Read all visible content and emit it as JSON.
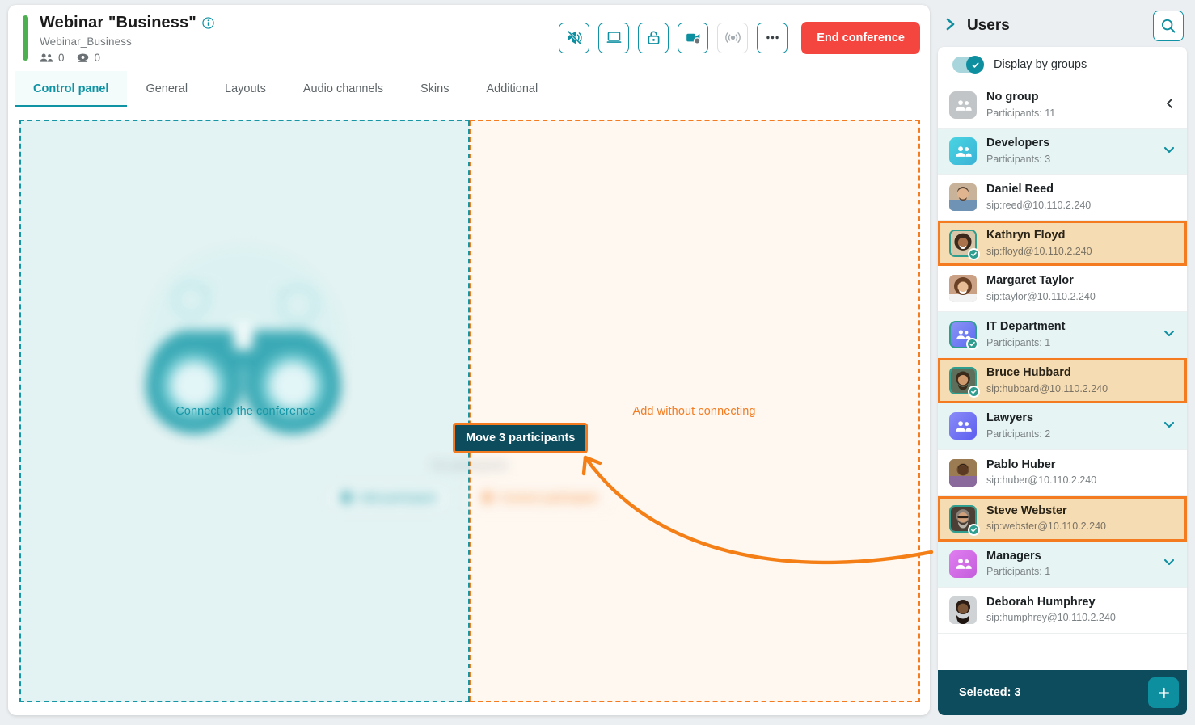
{
  "conference": {
    "title": "Webinar \"Business\"",
    "subtitle": "Webinar_Business",
    "participants_count": "0",
    "views_count": "0",
    "info_icon": "info-icon",
    "accent_color": "#4caf50"
  },
  "toolbar": {
    "buttons": [
      {
        "name": "mute-all-icon",
        "enabled": true
      },
      {
        "name": "screen-share-icon",
        "enabled": true
      },
      {
        "name": "lock-icon",
        "enabled": true
      },
      {
        "name": "recording-icon",
        "enabled": true
      },
      {
        "name": "broadcast-icon",
        "enabled": false
      },
      {
        "name": "more-options-icon",
        "enabled": true
      }
    ],
    "end_conference_label": "End conference",
    "end_conference_color": "#f4453f"
  },
  "tabs": [
    {
      "label": "Control panel",
      "active": true
    },
    {
      "label": "General",
      "active": false
    },
    {
      "label": "Layouts",
      "active": false
    },
    {
      "label": "Audio channels",
      "active": false
    },
    {
      "label": "Skins",
      "active": false
    },
    {
      "label": "Additional",
      "active": false
    }
  ],
  "dropzones": {
    "left": {
      "label": "Connect to the conference",
      "color": "#1696a5",
      "bg": "#e3f2f2"
    },
    "right": {
      "label": "Add without connecting",
      "color": "#f47b20",
      "bg": "#fef8f1"
    },
    "background_art": {
      "icon": "binoculars-icon",
      "faded_text": "No participants",
      "faded_buttons": [
        {
          "label": "Add participant",
          "color": "#1696a5"
        },
        {
          "label": "Connect participant",
          "color": "#f47b20"
        }
      ]
    },
    "drag_tooltip": "Move 3 participants",
    "drag_tooltip_bg": "#0d4c5c",
    "drag_tooltip_border": "#f47b20"
  },
  "users_panel": {
    "collapse_icon": "chevron-right-icon",
    "title": "Users",
    "search_icon": "search-icon",
    "display_by_groups": {
      "label": "Display by groups",
      "enabled": true
    },
    "selected_bar": {
      "label": "Selected: 3",
      "add_icon": "plus-icon"
    },
    "rows": [
      {
        "kind": "group",
        "name": "No group",
        "sub": "Participants: 11",
        "icon": "group-icon",
        "icon_color": "#c2c5c7",
        "chevron": "chevron-left-icon",
        "checked": false,
        "highlighted": false
      },
      {
        "kind": "group",
        "name": "Developers",
        "sub": "Participants: 3",
        "icon": "group-icon",
        "icon_color": "#3fc0d8",
        "chevron": "chevron-down-icon",
        "checked": false,
        "highlighted": true
      },
      {
        "kind": "user",
        "name": "Daniel Reed",
        "sub": "sip:reed@10.110.2.240",
        "icon": "avatar",
        "avatar_tone": "#a9825f",
        "checked": false,
        "selected": false
      },
      {
        "kind": "user",
        "name": "Kathryn Floyd",
        "sub": "sip:floyd@10.110.2.240",
        "icon": "avatar",
        "avatar_tone": "#8a6a4a",
        "checked": true,
        "selected": true
      },
      {
        "kind": "user",
        "name": "Margaret Taylor",
        "sub": "sip:taylor@10.110.2.240",
        "icon": "avatar",
        "avatar_tone": "#b08a6c",
        "checked": false,
        "selected": false
      },
      {
        "kind": "group",
        "name": "IT Department",
        "sub": "Participants: 1",
        "icon": "group-icon",
        "icon_color": "#6a7cf0",
        "chevron": "chevron-down-icon",
        "checked": true,
        "highlighted": true
      },
      {
        "kind": "user",
        "name": "Bruce Hubbard",
        "sub": "sip:hubbard@10.110.2.240",
        "icon": "avatar",
        "avatar_tone": "#6e533c",
        "checked": true,
        "selected": true
      },
      {
        "kind": "group",
        "name": "Lawyers",
        "sub": "Participants: 2",
        "icon": "group-icon",
        "icon_color": "#6a6cf0",
        "chevron": "chevron-down-icon",
        "checked": false,
        "highlighted": true
      },
      {
        "kind": "user",
        "name": "Pablo Huber",
        "sub": "sip:huber@10.110.2.240",
        "icon": "avatar",
        "avatar_tone": "#5b4632",
        "checked": false,
        "selected": false
      },
      {
        "kind": "user",
        "name": "Steve Webster",
        "sub": "sip:webster@10.110.2.240",
        "icon": "avatar",
        "avatar_tone": "#4e4036",
        "checked": true,
        "selected": true
      },
      {
        "kind": "group",
        "name": "Managers",
        "sub": "Participants: 1",
        "icon": "group-icon",
        "icon_color": "#d06ce0",
        "chevron": "chevron-down-icon",
        "checked": false,
        "highlighted": true
      },
      {
        "kind": "user",
        "name": "Deborah Humphrey",
        "sub": "sip:humphrey@10.110.2.240",
        "icon": "avatar",
        "avatar_tone": "#4a3a30",
        "checked": false,
        "selected": false
      }
    ]
  }
}
